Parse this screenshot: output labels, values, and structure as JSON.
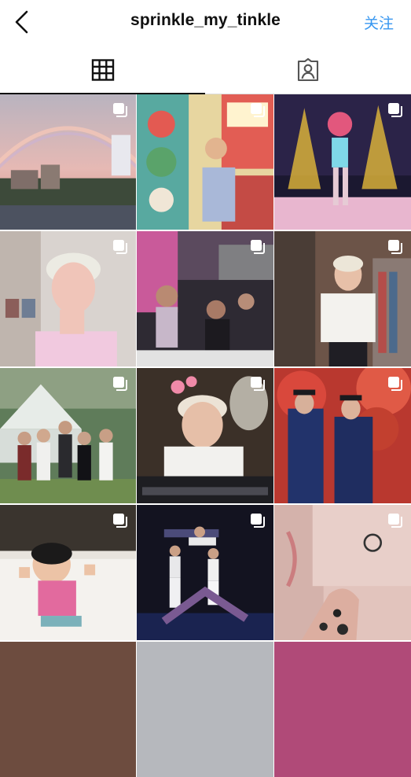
{
  "header": {
    "username": "sprinkle_my_tinkle",
    "follow_label": "关注",
    "back_icon": "chevron-left-icon",
    "accent_color": "#3897f0"
  },
  "tabs": [
    {
      "name": "grid",
      "icon": "grid-icon",
      "active": true
    },
    {
      "name": "tagged",
      "icon": "tagged-user-icon",
      "active": false
    }
  ],
  "posts": [
    {
      "type": "carousel",
      "subject": "rainbow over city"
    },
    {
      "type": "carousel",
      "subject": "person by colorful shop"
    },
    {
      "type": "carousel",
      "subject": "neon illustration"
    },
    {
      "type": "carousel",
      "subject": "bleached hair portrait"
    },
    {
      "type": "carousel",
      "subject": "party crowd"
    },
    {
      "type": "carousel",
      "subject": "person in white t-shirt"
    },
    {
      "type": "carousel",
      "subject": "group photo by tent"
    },
    {
      "type": "carousel",
      "subject": "selfie at laptop"
    },
    {
      "type": "carousel",
      "subject": "graduation couple"
    },
    {
      "type": "carousel",
      "subject": "child on bed"
    },
    {
      "type": "carousel",
      "subject": "dance performance"
    },
    {
      "type": "carousel",
      "subject": "tattoo on hand"
    }
  ]
}
